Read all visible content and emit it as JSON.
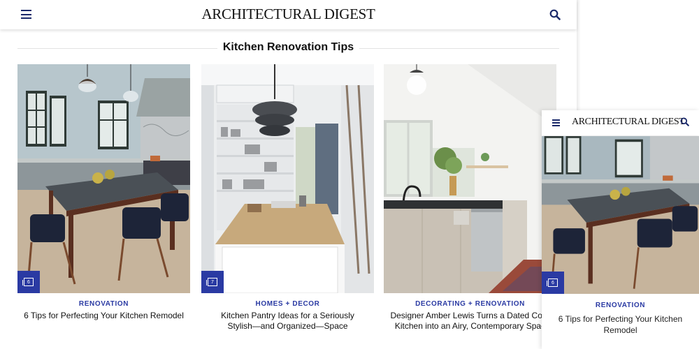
{
  "header": {
    "logo": "ARCHITECTURAL DIGEST",
    "menu_icon": "hamburger-menu-icon",
    "search_icon": "search-icon"
  },
  "section": {
    "title": "Kitchen Renovation Tips"
  },
  "cards": [
    {
      "category": "RENOVATION",
      "headline_lines": [
        "6 Tips for Perfecting Your Kitchen Remodel"
      ],
      "gallery_count": "6"
    },
    {
      "category": "HOMES + DECOR",
      "headline_lines": [
        "Kitchen Pantry Ideas for a Seriously",
        "Stylish—and Organized—Space"
      ],
      "gallery_count": "7"
    },
    {
      "category": "DECORATING + RENOVATION",
      "headline_lines": [
        "Designer Amber Lewis Turns a Dated Cour",
        "Kitchen into an Airy, Contemporary Spac"
      ],
      "gallery_count": ""
    }
  ],
  "mobile": {
    "logo": "ARCHITECTURAL DIGEST",
    "category": "RENOVATION",
    "headline": "6 Tips for Perfecting Your Kitchen Remodel",
    "gallery_count": "6"
  },
  "colors": {
    "accent": "#2a3aa3",
    "nav": "#1b2a6b",
    "text": "#111111"
  }
}
